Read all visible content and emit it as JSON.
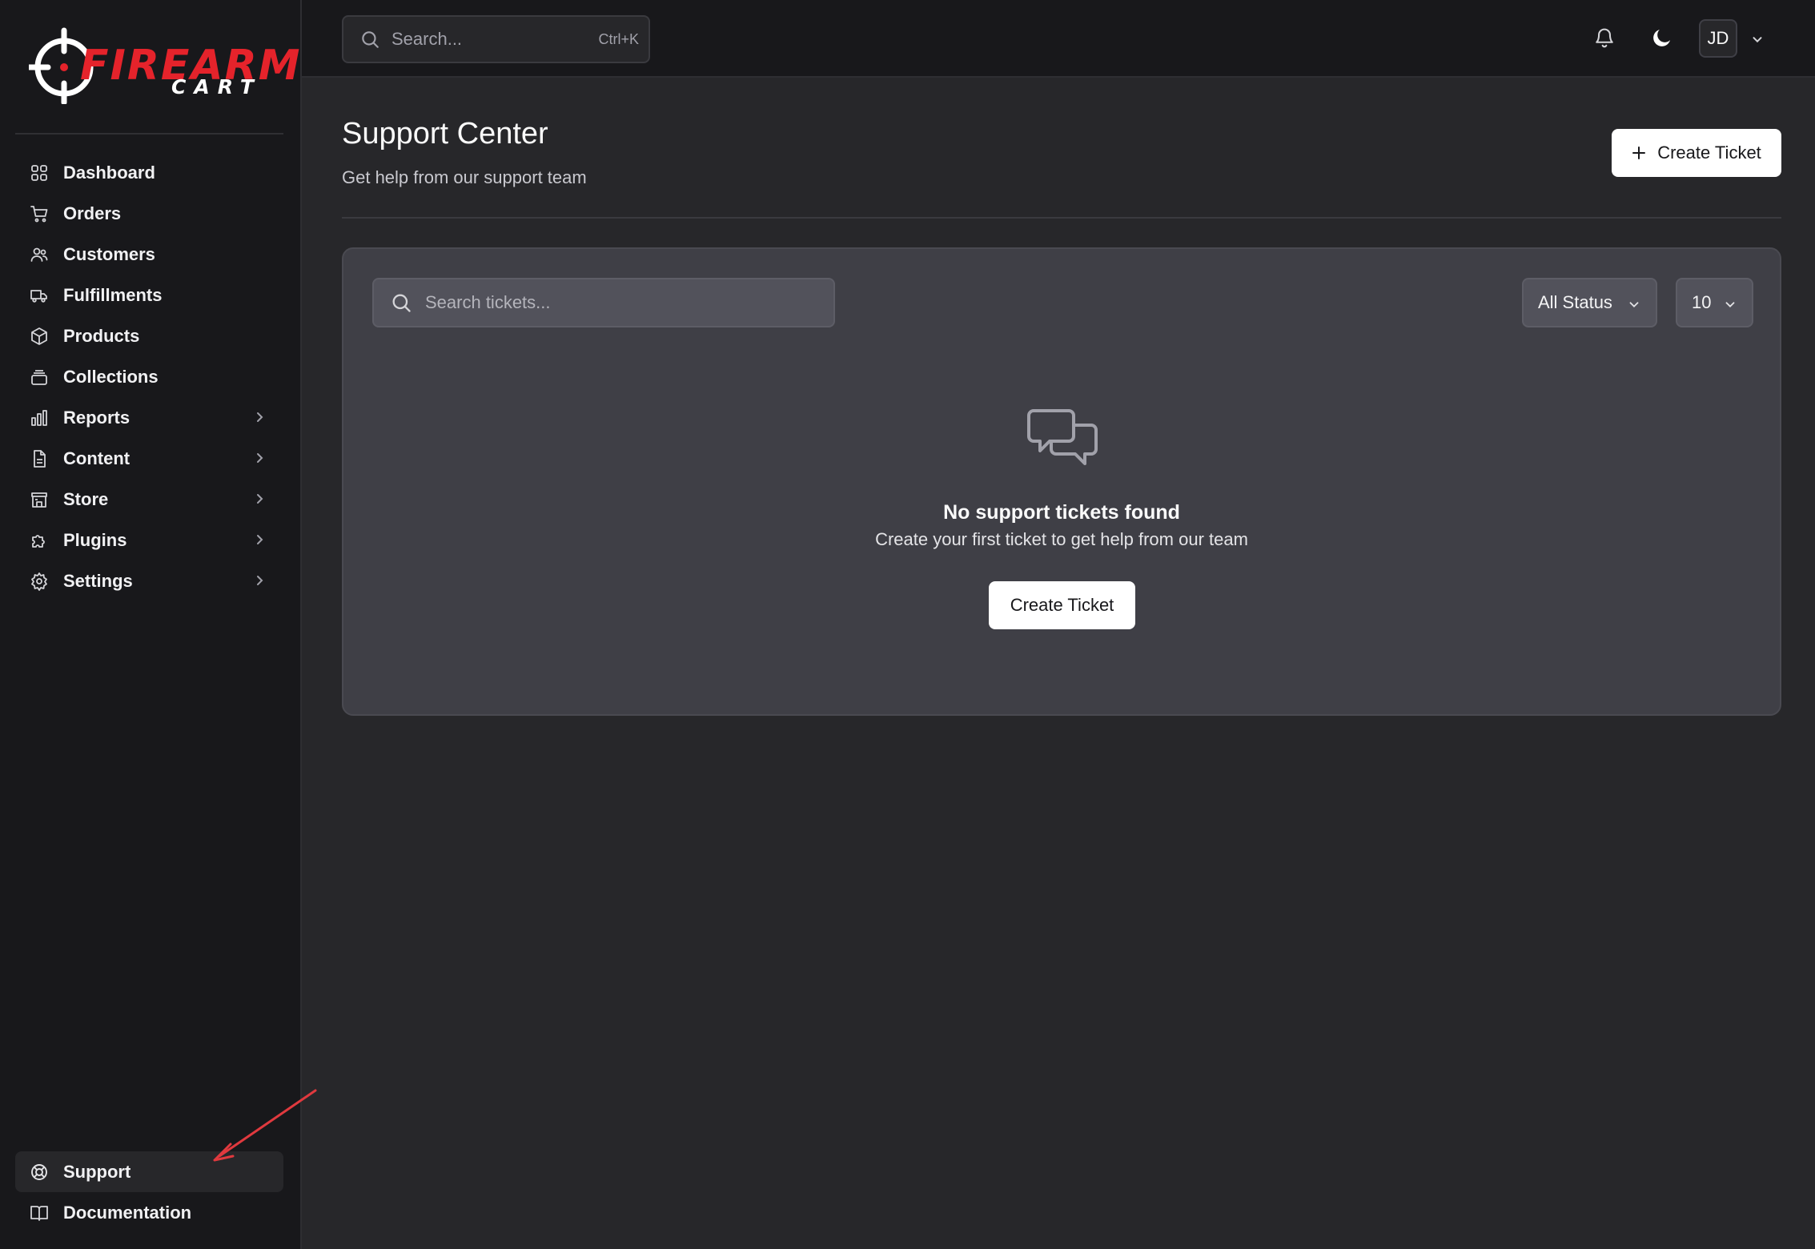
{
  "brand": {
    "name_line1": "FIREARM",
    "name_line2": "CART",
    "colors": {
      "accent": "#e5232b",
      "bg": "#27272a",
      "sidebar_bg": "#18181b"
    }
  },
  "sidebar": {
    "items": [
      {
        "label": "Dashboard",
        "icon": "dashboard-grid-icon",
        "has_submenu": false
      },
      {
        "label": "Orders",
        "icon": "cart-icon",
        "has_submenu": false
      },
      {
        "label": "Customers",
        "icon": "users-icon",
        "has_submenu": false
      },
      {
        "label": "Fulfillments",
        "icon": "truck-icon",
        "has_submenu": false
      },
      {
        "label": "Products",
        "icon": "box-icon",
        "has_submenu": false
      },
      {
        "label": "Collections",
        "icon": "layers-icon",
        "has_submenu": false
      },
      {
        "label": "Reports",
        "icon": "bar-chart-icon",
        "has_submenu": true
      },
      {
        "label": "Content",
        "icon": "file-icon",
        "has_submenu": true
      },
      {
        "label": "Store",
        "icon": "store-icon",
        "has_submenu": true
      },
      {
        "label": "Plugins",
        "icon": "puzzle-icon",
        "has_submenu": true
      },
      {
        "label": "Settings",
        "icon": "gear-icon",
        "has_submenu": true
      }
    ],
    "bottom_items": [
      {
        "label": "Support",
        "icon": "lifebuoy-icon",
        "active": true
      },
      {
        "label": "Documentation",
        "icon": "book-icon",
        "active": false
      }
    ]
  },
  "topbar": {
    "search_placeholder": "Search...",
    "search_shortcut": "Ctrl+K",
    "user_initials": "JD"
  },
  "page": {
    "title": "Support Center",
    "subtitle": "Get help from our support team",
    "create_button": "Create Ticket"
  },
  "tickets": {
    "search_placeholder": "Search tickets...",
    "status_filter": "All Status",
    "per_page": "10",
    "empty_title": "No support tickets found",
    "empty_description": "Create your first ticket to get help from our team",
    "empty_button": "Create Ticket"
  }
}
